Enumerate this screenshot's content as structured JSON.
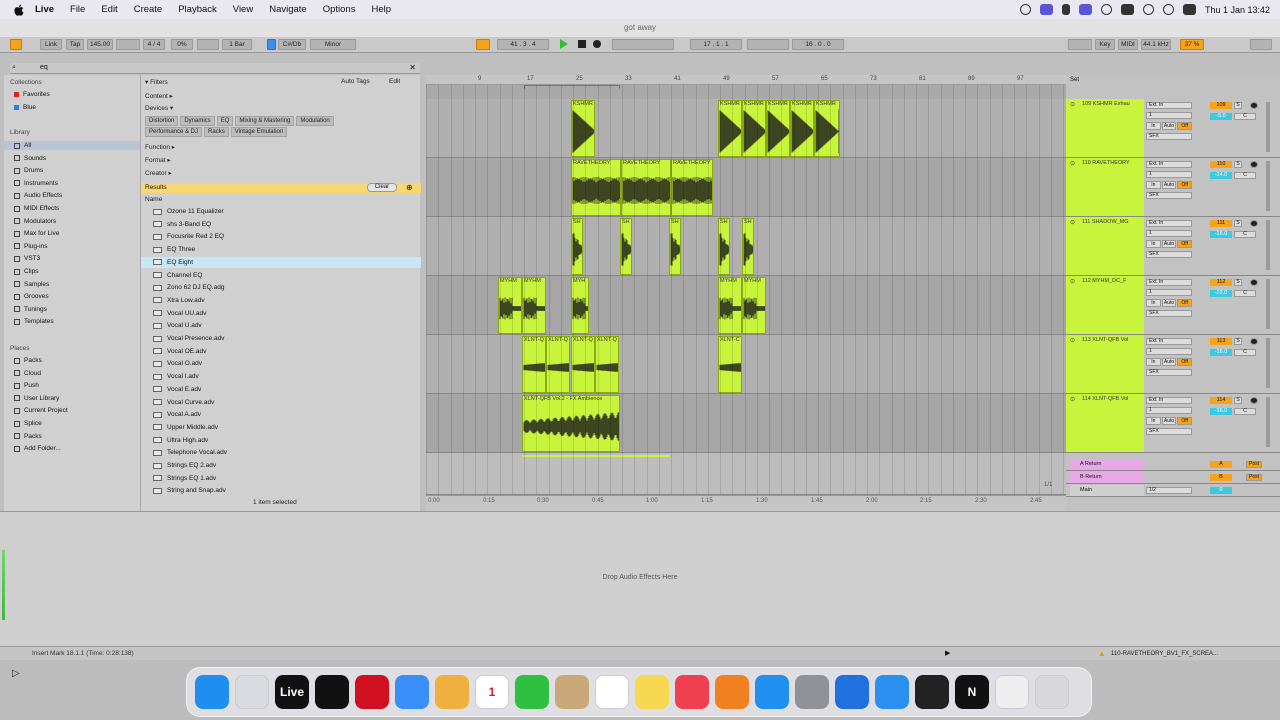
{
  "menubar": {
    "apple": "",
    "items": [
      "Live",
      "File",
      "Edit",
      "Create",
      "Playback",
      "View",
      "Navigate",
      "Options",
      "Help"
    ],
    "clock": "Thu 1 Jan  13:42"
  },
  "window": {
    "title": "got away"
  },
  "transport": {
    "link": "Link",
    "tap": "Tap",
    "tempo": "145.00",
    "sig": "4 / 4",
    "pct": "0%",
    "quant": "1 Bar",
    "key": "C#/Db",
    "scale": "Minor",
    "pos": "41 . 3 . 4",
    "loop_start": "17 . 1 . 1",
    "loop_len": "16 . 0 . 0",
    "key_label": "Key",
    "midi_label": "MIDI",
    "sample_rate": "44.1 kHz",
    "cpu": "37 %"
  },
  "browser": {
    "search_value": "eq",
    "collections_label": "Collections",
    "collections": [
      {
        "label": "Favorites",
        "color": "#e02020"
      },
      {
        "label": "Blue",
        "color": "#2a7ff0"
      }
    ],
    "library_label": "Library",
    "library": [
      "All",
      "Sounds",
      "Drums",
      "Instruments",
      "Audio Effects",
      "MIDI Effects",
      "Modulators",
      "Max for Live",
      "Plug-ins",
      "VST3",
      "Clips",
      "Samples",
      "Grooves",
      "Tunings",
      "Templates"
    ],
    "places_label": "Places",
    "places": [
      "Packs",
      "Cloud",
      "Push",
      "User Library",
      "Current Project",
      "Splice",
      "Packs",
      "Add Folder..."
    ]
  },
  "filters": {
    "filters_label": "Filters",
    "auto_tags": "Auto Tags",
    "edit": "Edit",
    "content": "Content",
    "devices": "Devices",
    "tags": [
      "Distortion",
      "Dynamics",
      "EQ",
      "Mixing & Mastering",
      "Modulation",
      "Performance & DJ",
      "Racks",
      "Vintage Emulation"
    ],
    "function": "Function",
    "format": "Format",
    "creator": "Creator",
    "results": "Results",
    "clear": "Clear",
    "name_col": "Name",
    "items": [
      "Ozone 11 Equalizer",
      "shs 3-Band EQ",
      "Focusrite Red 2 EQ",
      "EQ Three",
      "EQ Eight",
      "Channel EQ",
      "Zono 62 DJ EQ.adg",
      "Xtra Low.adv",
      "Vocal UU.adv",
      "Vocal U.adv",
      "Vocal Presence.adv",
      "Vocal OE.adv",
      "Vocal O.adv",
      "Vocal I.adv",
      "Vocal E.adv",
      "Vocal Curve.adv",
      "Vocal A.adv",
      "Upper Middle.adv",
      "Ultra High.adv",
      "Telephone Vocal.adv",
      "Strings EQ 2.adv",
      "Strings EQ 1.adv",
      "String and Snap.adv"
    ],
    "selected_index": 4,
    "selected_count": "1 item selected"
  },
  "arrangement": {
    "bars": [
      "9",
      "17",
      "25",
      "33",
      "41",
      "49",
      "57",
      "65",
      "73",
      "81",
      "89",
      "97"
    ],
    "times": [
      "0:00",
      "0:15",
      "0:30",
      "0:45",
      "1:00",
      "1:15",
      "1:30",
      "1:45",
      "2:00",
      "2:15",
      "2:30",
      "2:45"
    ],
    "page": "1/1",
    "tracks": [
      {
        "clips": [
          {
            "name": "KSHMR"
          },
          {
            "name": "KSHMR"
          },
          {
            "name": "KSHMR"
          },
          {
            "name": "KSHMR"
          },
          {
            "name": "KSHMR"
          },
          {
            "name": "KSHMR"
          }
        ]
      },
      {
        "clips": [
          {
            "name": "RAVETHEORY"
          },
          {
            "name": "RAVETHEORY"
          },
          {
            "name": "RAVETHEORY"
          }
        ]
      },
      {
        "clips": [
          {
            "name": "SH"
          },
          {
            "name": "SH"
          },
          {
            "name": "SH"
          },
          {
            "name": "SH"
          },
          {
            "name": "SH"
          }
        ]
      },
      {
        "clips": [
          {
            "name": "MYHM"
          },
          {
            "name": "MYHM"
          },
          {
            "name": "MYH"
          },
          {
            "name": "MYHM"
          },
          {
            "name": "MYHM"
          }
        ]
      },
      {
        "clips": [
          {
            "name": "XLNT-Q"
          },
          {
            "name": "XLNT-Q"
          },
          {
            "name": "XLNT-Q"
          },
          {
            "name": "XLNT-Q"
          },
          {
            "name": "XLNT-C"
          }
        ]
      },
      {
        "clips": [
          {
            "name": "XLNT-QFB Vol.2 - FX Ambience"
          }
        ]
      }
    ]
  },
  "mixer": {
    "set_label": "Set",
    "tracks": [
      {
        "name": "109 KSHMR Exhau",
        "input": "Ext. In",
        "ch": "1",
        "out": "SFX",
        "num": "109",
        "vol": "-5.0",
        "pan": "C"
      },
      {
        "name": "110 RAVETHEORY",
        "input": "Ext. In",
        "ch": "1",
        "out": "SFX",
        "num": "110",
        "vol": "-24.0",
        "pan": "C"
      },
      {
        "name": "111 SHADOW_MG",
        "input": "Ext. In",
        "ch": "1",
        "out": "SFX",
        "num": "111",
        "vol": "-16.0",
        "pan": "C"
      },
      {
        "name": "112 MYHM_DC_F",
        "input": "Ext. In",
        "ch": "1",
        "out": "SFX",
        "num": "112",
        "vol": "-22.0",
        "pan": "C"
      },
      {
        "name": "113 XLNT-QFB Vol",
        "input": "Ext. In",
        "ch": "1",
        "out": "SFX",
        "num": "113",
        "vol": "-16.0",
        "pan": "C"
      },
      {
        "name": "114 XLNT-QFB Vol",
        "input": "Ext. In",
        "ch": "1",
        "out": "SFX",
        "num": "114",
        "vol": "-16.0",
        "pan": "C"
      }
    ],
    "in_label": "In",
    "auto_label": "Auto",
    "off_label": "Off",
    "returns": [
      {
        "name": "A Return",
        "letter": "A",
        "post": "Post"
      },
      {
        "name": "B Return",
        "letter": "B",
        "post": "Post"
      }
    ],
    "main": {
      "name": "Main",
      "ch": "1/2",
      "vol": "0"
    }
  },
  "device": {
    "drop": "Drop Audio Effects Here"
  },
  "status": {
    "text": "Insert Mark 18.1.1 (Time: 0:28:138)",
    "clip": "110-RAVETHEORY_BV1_FX_SCREA..."
  },
  "dock": {
    "apps": [
      {
        "name": "Finder",
        "color": "#1e8ef0"
      },
      {
        "name": "Launchpad",
        "color": "#d9d9e0"
      },
      {
        "name": "Live",
        "color": "#111111",
        "label": "Live"
      },
      {
        "name": "Splice",
        "color": "#111111"
      },
      {
        "name": "Opera",
        "color": "#d01020"
      },
      {
        "name": "Mail",
        "color": "#3a8ef8"
      },
      {
        "name": "Photos",
        "color": "#f0b040"
      },
      {
        "name": "Calendar",
        "color": "#ffffff",
        "label": "1"
      },
      {
        "name": "Messages",
        "color": "#30c040"
      },
      {
        "name": "Contacts",
        "color": "#c8a878"
      },
      {
        "name": "Reminders",
        "color": "#ffffff"
      },
      {
        "name": "Notes",
        "color": "#f5d850"
      },
      {
        "name": "Music",
        "color": "#f04050"
      },
      {
        "name": "Pages",
        "color": "#f08020"
      },
      {
        "name": "App Store",
        "color": "#2090f0"
      },
      {
        "name": "System Settings",
        "color": "#909098"
      },
      {
        "name": "Preview",
        "color": "#2070e0"
      },
      {
        "name": "Safari",
        "color": "#2a90f0"
      },
      {
        "name": "OBS",
        "color": "#222222"
      },
      {
        "name": "Native Instruments",
        "color": "#111111",
        "label": "N"
      },
      {
        "name": "Chrome",
        "color": "#eeeeee"
      },
      {
        "name": "Trash",
        "color": "#d8d8dc"
      }
    ]
  }
}
